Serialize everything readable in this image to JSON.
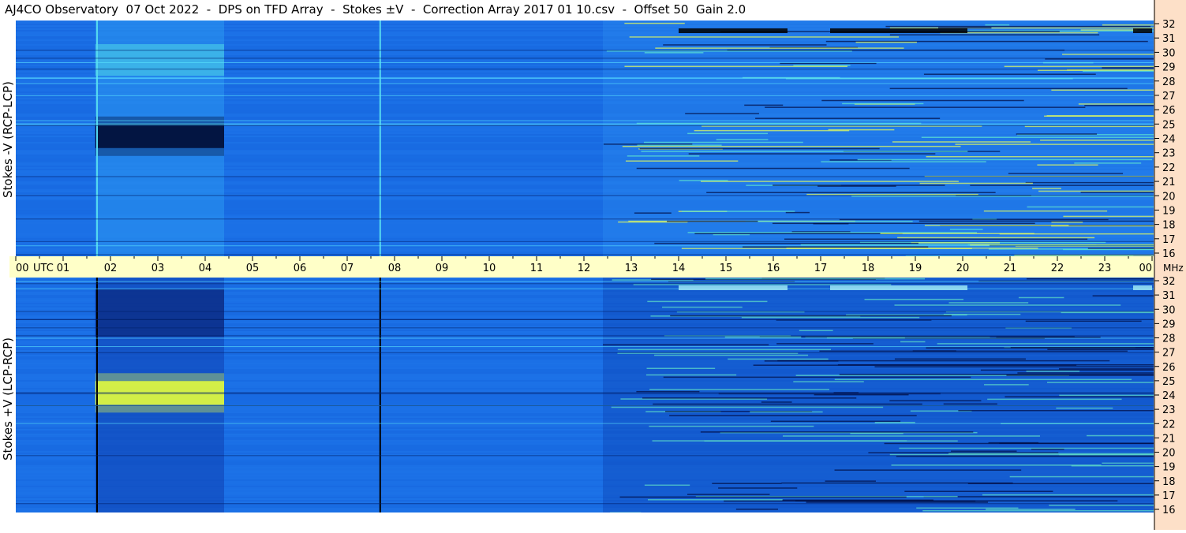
{
  "title": "AJ4CO Observatory  07 Oct 2022  -  DPS on TFD Array  -  Stokes ±V  -  Correction Array 2017 01 10.csv  -  Offset 50  Gain 2.0",
  "chart_data": {
    "type": "heatmap",
    "x_tick_labels": [
      "00",
      "01",
      "02",
      "03",
      "04",
      "05",
      "06",
      "07",
      "08",
      "09",
      "10",
      "11",
      "12",
      "13",
      "14",
      "15",
      "16",
      "17",
      "18",
      "19",
      "20",
      "21",
      "22",
      "23",
      "00"
    ],
    "x_unit_label": "UTC",
    "y_unit_label": "MHz",
    "xlim_hours": [
      0,
      24
    ],
    "panels": [
      {
        "name": "Stokes -V (RCP-LCP)",
        "ylim_mhz": [
          16,
          32
        ],
        "y_tick_labels": [
          "32",
          "31",
          "30",
          "29",
          "28",
          "27",
          "26",
          "25",
          "24",
          "23",
          "22",
          "21",
          "20",
          "19",
          "18",
          "17",
          "16"
        ]
      },
      {
        "name": "Stokes +V (LCP-RCP)",
        "ylim_mhz": [
          16,
          32
        ],
        "y_tick_labels": [
          "32",
          "31",
          "30",
          "29",
          "28",
          "27",
          "26",
          "25",
          "24",
          "23",
          "22",
          "21",
          "20",
          "19",
          "18",
          "17",
          "16"
        ]
      }
    ],
    "colors": {
      "background": "#1a6fe6",
      "freq_strip": "#fde0c8",
      "time_axis": "#ffffc8"
    }
  }
}
